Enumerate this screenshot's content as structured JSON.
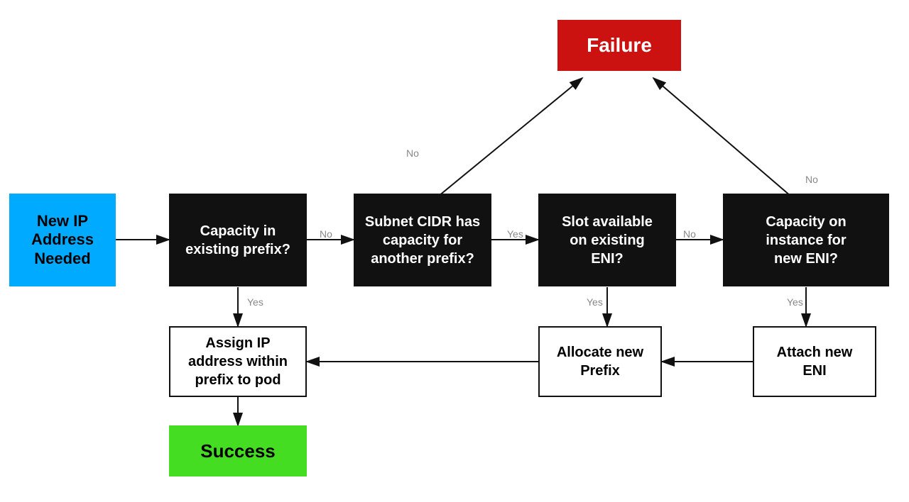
{
  "nodes": {
    "new_ip": {
      "label": "New IP\nAddress\nNeeded"
    },
    "capacity_existing": {
      "label": "Capacity in\nexisting prefix?"
    },
    "subnet_cidr": {
      "label": "Subnet CIDR has\ncapacity for\nanother prefix?"
    },
    "slot_available": {
      "label": "Slot available\non existing\nENI?"
    },
    "capacity_instance": {
      "label": "Capacity on\ninstance for\nnew ENI?"
    },
    "failure": {
      "label": "Failure"
    },
    "assign_ip": {
      "label": "Assign IP\naddress within\nprefix to pod"
    },
    "allocate_prefix": {
      "label": "Allocate new\nPrefix"
    },
    "attach_eni": {
      "label": "Attach new\nENI"
    },
    "success": {
      "label": "Success"
    }
  },
  "labels": {
    "no1": "No",
    "no2": "No",
    "no3": "No",
    "no4": "No",
    "yes1": "Yes",
    "yes2": "Yes",
    "yes3": "Yes"
  },
  "colors": {
    "blue": "#00aaff",
    "black": "#111111",
    "red": "#cc1111",
    "green": "#44dd22",
    "white": "#ffffff",
    "arrow": "#111111",
    "label": "#888888"
  }
}
